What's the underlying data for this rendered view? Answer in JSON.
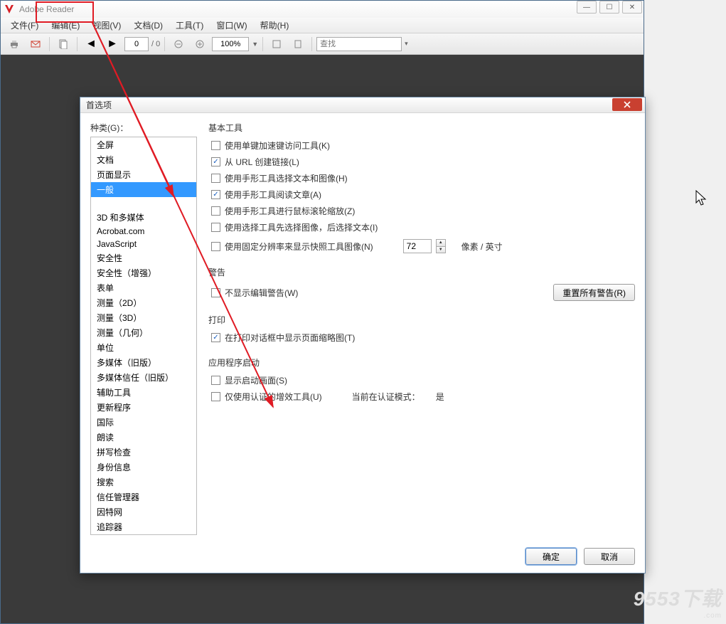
{
  "app": {
    "title": "Adobe Reader"
  },
  "window_controls": {
    "min": "—",
    "max": "☐",
    "close": "✕"
  },
  "menu": {
    "file": "文件(F)",
    "edit": "编辑(E)",
    "view": "视图(V)",
    "document": "文档(D)",
    "tools": "工具(T)",
    "window": "窗口(W)",
    "help": "帮助(H)"
  },
  "toolbar": {
    "page_value": "0",
    "page_total": "/ 0",
    "zoom_value": "100%",
    "search_placeholder": "查找"
  },
  "dialog": {
    "title": "首选项",
    "category_label": "种类(G)：",
    "categories": [
      "全屏",
      "文档",
      "页面显示",
      "一般",
      "",
      "3D 和多媒体",
      "Acrobat.com",
      "JavaScript",
      "安全性",
      "安全性（增强）",
      "表单",
      "测量（2D）",
      "测量（3D）",
      "测量（几何）",
      "单位",
      "多媒体（旧版）",
      "多媒体信任（旧版）",
      "辅助工具",
      "更新程序",
      "国际",
      "朗读",
      "拼写检查",
      "身份信息",
      "搜索",
      "信任管理器",
      "因特网",
      "追踪器"
    ],
    "selected_index": 3,
    "groups": {
      "basic_tools": {
        "title": "基本工具",
        "items": [
          {
            "checked": false,
            "label": "使用单键加速键访问工具(K)"
          },
          {
            "checked": true,
            "label": "从 URL 创建链接(L)"
          },
          {
            "checked": false,
            "label": "使用手形工具选择文本和图像(H)"
          },
          {
            "checked": true,
            "label": "使用手形工具阅读文章(A)"
          },
          {
            "checked": false,
            "label": "使用手形工具进行鼠标滚轮缩放(Z)"
          },
          {
            "checked": false,
            "label": "使用选择工具先选择图像，后选择文本(I)"
          }
        ],
        "fixed_res": {
          "checked": false,
          "label": "使用固定分辨率来显示快照工具图像(N)",
          "value": "72",
          "unit": "像素 / 英寸"
        }
      },
      "warnings": {
        "title": "警告",
        "hide_edit": {
          "checked": false,
          "label": "不显示编辑警告(W)"
        },
        "reset_btn": "重置所有警告(R)"
      },
      "printing": {
        "title": "打印",
        "thumb": {
          "checked": true,
          "label": "在打印对话框中显示页面缩略图(T)"
        }
      },
      "startup": {
        "title": "应用程序启动",
        "splash": {
          "checked": false,
          "label": "显示启动画面(S)"
        },
        "certified": {
          "checked": false,
          "label": "仅使用认证的增效工具(U)"
        },
        "mode_label": "当前在认证模式：",
        "mode_value": "是"
      }
    },
    "buttons": {
      "ok": "确定",
      "cancel": "取消"
    }
  },
  "watermark": {
    "main": "9553下载",
    "sub": ".com"
  }
}
